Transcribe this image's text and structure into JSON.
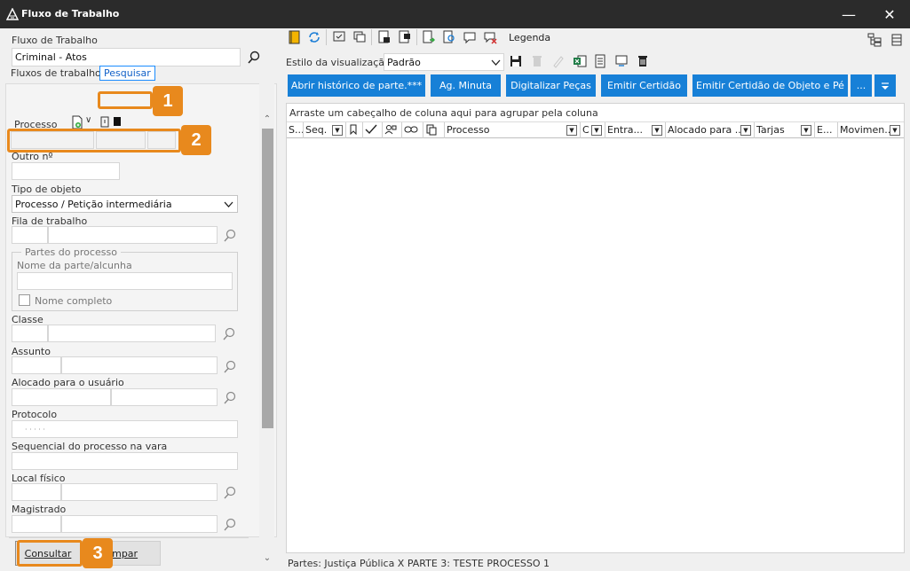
{
  "window": {
    "title": "Fluxo de Trabalho",
    "minimize": "—",
    "close": "✕"
  },
  "left": {
    "workflow_label": "Fluxo de Trabalho",
    "workflow_value": "Criminal - Atos",
    "tabs": [
      "Fluxos de trabalho",
      "Pesquisar"
    ],
    "processo_label": "Processo",
    "outro_label": "Outro nº",
    "tipo_label": "Tipo de objeto",
    "tipo_value": "Processo / Petição intermediária",
    "fila_label": "Fila de trabalho",
    "partes_title": "Partes do processo",
    "nome_parte_label": "Nome da parte/alcunha",
    "nome_completo_label": "Nome completo",
    "classe_label": "Classe",
    "assunto_label": "Assunto",
    "alocado_label": "Alocado para o usuário",
    "protocolo_label": "Protocolo",
    "protocolo_value": "· · · · ·",
    "sequencial_label": "Sequencial do processo na vara",
    "local_label": "Local físico",
    "magistrado_label": "Magistrado",
    "consultar": "Consultar",
    "limpar": "Limpar"
  },
  "callouts": [
    "1",
    "2",
    "3"
  ],
  "right": {
    "legenda": "Legenda",
    "estilo_label": "Estilo da visualização",
    "estilo_value": "Padrão",
    "buttons": [
      "Abrir histórico de parte.***",
      "Ag. Minuta",
      "Digitalizar Peças",
      "Emitir Certidão",
      "Emitir Certidão de Objeto e Pé",
      "..."
    ],
    "group_hint": "Arraste um cabeçalho de coluna aqui para agrupar pela coluna",
    "columns": [
      "S...",
      "Seq.",
      "",
      "",
      "",
      "",
      "",
      "Processo",
      "C",
      "Entra...",
      "Alocado para ...",
      "Tarjas",
      "E...",
      "Movimen..."
    ],
    "status": "Partes: Justiça Pública  X  PARTE 3: TESTE PROCESSO 1"
  },
  "colors": {
    "accent": "#1780d7",
    "callout": "#e8891d",
    "titlebar": "#2b2b2b"
  }
}
